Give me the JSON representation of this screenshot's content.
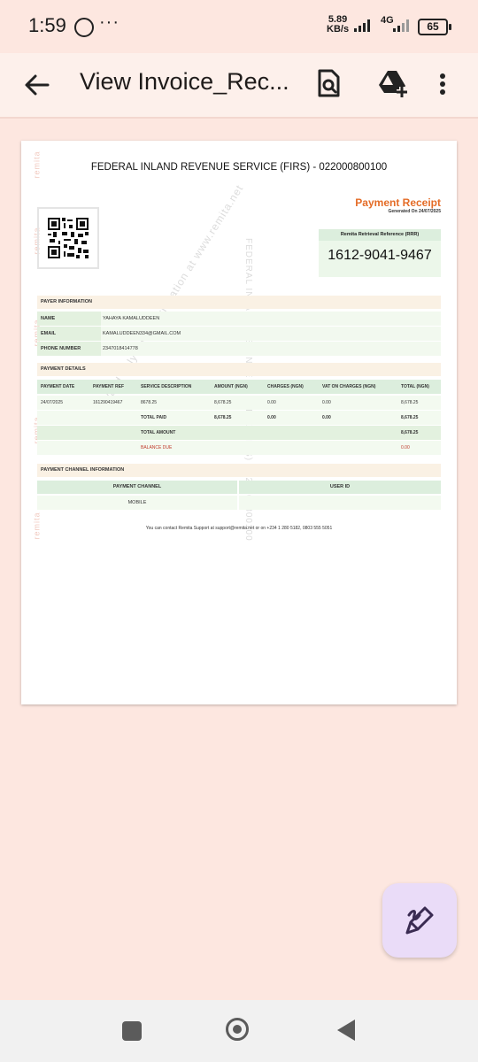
{
  "status_bar": {
    "time": "1:59",
    "more_indicator": "···",
    "net_speed_value": "5.89",
    "net_speed_unit": "KB/s",
    "network_type": "4G",
    "battery": "65"
  },
  "app_bar": {
    "title": "View Invoice_Rec...",
    "icons": [
      "back-arrow-icon",
      "document-search-icon",
      "drive-add-icon",
      "more-vert-icon"
    ]
  },
  "document": {
    "side_watermark": "remita",
    "watermark_text_1": "Valid only upon verification at www.remita.net",
    "watermark_text_2": "FEDERAL INLAND REVENUE SERVICE (FIRS) - 022000800100",
    "header": "FEDERAL INLAND REVENUE SERVICE (FIRS) - 022000800100",
    "receipt_title": "Payment Receipt",
    "generated_on": "Generated On 24/07/2025",
    "rrr_label": "Remita Retrieval Reference (RRR)",
    "rrr_value": "1612-9041-9467",
    "payer_section": "PAYER INFORMATION",
    "payer_rows": [
      {
        "label": "NAME",
        "value": "YAHAYA KAMALUDDEEN"
      },
      {
        "label": "EMAIL",
        "value": "KAMALUDDEEN334@GMAIL.COM"
      },
      {
        "label": "PHONE NUMBER",
        "value": "2347018414778"
      }
    ],
    "payment_section": "PAYMENT DETAILS",
    "payment_headers": [
      "PAYMENT DATE",
      "PAYMENT REF",
      "SERVICE DESCRIPTION",
      "AMOUNT (NGN)",
      "CHARGES (NGN)",
      "VAT ON CHARGES (NGN)",
      "TOTAL (NGN)"
    ],
    "payment_row": [
      "24/07/2025",
      "161290419467",
      "8678.25",
      "8,678.25",
      "0.00",
      "0.00",
      "8,678.25"
    ],
    "total_paid_row": [
      "TOTAL PAID",
      "8,678.25",
      "0.00",
      "0.00",
      "8,678.25"
    ],
    "total_amount_row": [
      "TOTAL AMOUNT",
      "8,678.25"
    ],
    "balance_due_row": [
      "BALANCE DUE",
      "0.00"
    ],
    "channel_section": "PAYMENT CHANNEL INFORMATION",
    "channel_headers": [
      "PAYMENT CHANNEL",
      "USER ID"
    ],
    "channel_row": [
      "MOBILE",
      ""
    ],
    "contact": "You can contact Remita Support at support@remita.net or on +234 1 280 5182, 0803 555 5051",
    "colors": {
      "accent_orange": "#e46c27",
      "balance_red": "#c0392b",
      "green_header": "#dceedd"
    }
  },
  "fab": {
    "icon": "edit-pen-icon"
  },
  "nav_bar": {
    "icons": [
      "recents-square-icon",
      "home-circle-icon",
      "back-triangle-icon"
    ]
  }
}
